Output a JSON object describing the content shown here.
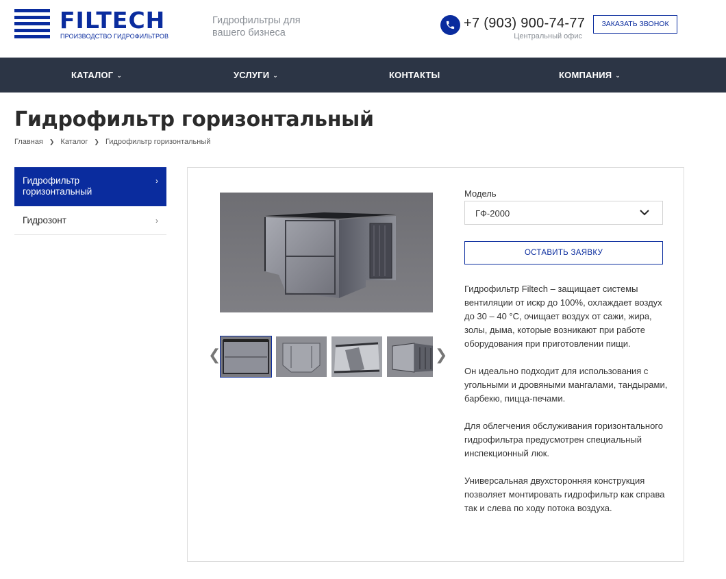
{
  "header": {
    "logo_name": "FILTECH",
    "logo_sub": "ПРОИЗВОДСТВО ГИДРОФИЛЬТРОВ",
    "tagline": "Гидрофильтры для вашего бизнеса",
    "phone": "+7 (903) 900-74-77",
    "office": "Центральный офис",
    "call_button": "ЗАКАЗАТЬ ЗВОНОК"
  },
  "nav": {
    "items": [
      {
        "label": "КАТАЛОГ",
        "has_dropdown": true
      },
      {
        "label": "УСЛУГИ",
        "has_dropdown": true
      },
      {
        "label": "КОНТАКТЫ",
        "has_dropdown": false
      },
      {
        "label": "КОМПАНИЯ",
        "has_dropdown": true
      }
    ]
  },
  "page": {
    "title": "Гидрофильтр горизонтальный",
    "breadcrumb": [
      "Главная",
      "Каталог",
      "Гидрофильтр горизонтальный"
    ]
  },
  "sidebar": {
    "items": [
      {
        "label": "Гидрофильтр горизонтальный",
        "active": true
      },
      {
        "label": "Гидрозонт",
        "active": false
      }
    ]
  },
  "product": {
    "model_label": "Модель",
    "model_value": "ГФ-2000",
    "apply_button": "ОСТАВИТЬ ЗАЯВКУ",
    "description": [
      "Гидрофильтр Filtech – защищает системы вентиляции от искр до 100%, охлаждает воздух до 30 – 40 °С, очищает воздух от сажи, жира, золы, дыма, которые возникают при работе оборудования при приготовлении пищи.",
      "Он идеально подходит для использования с угольными и дровяными мангалами, тандырами, барбекю, пицца-печами.",
      "Для облегчения обслуживания горизонтального гидрофильтра предусмотрен специальный инспекционный люк.",
      "Универсальная двухсторонняя конструкция позволяет монтировать гидрофильтр как справа так и слева по ходу потока воздуха."
    ]
  },
  "colors": {
    "brand_blue": "#0a2c9e",
    "nav_bg": "#2c3545"
  },
  "icons": {
    "phone": "phone-icon",
    "select": "chevron-down-icon",
    "gallery_prev": "chevron-left-icon",
    "gallery_next": "chevron-right-icon"
  }
}
